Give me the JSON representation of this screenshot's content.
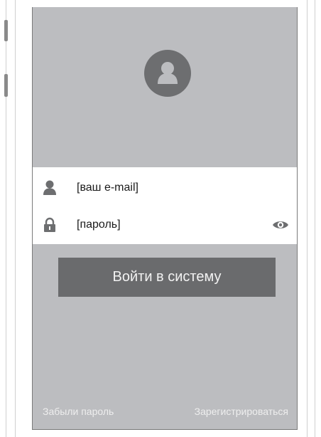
{
  "login": {
    "email_placeholder": "[ваш e-mail]",
    "password_placeholder": "[пароль]",
    "submit_label": "Войти в систему"
  },
  "footer": {
    "forgot_password": "Забыли пароль",
    "register": "Зарегистрироваться"
  },
  "icons": {
    "avatar": "user-avatar-icon",
    "email": "user-icon",
    "password": "lock-icon",
    "show_password": "eye-icon"
  },
  "colors": {
    "screen_background": "#bcbdc0",
    "form_background": "#ffffff",
    "button_background": "#6a6b6d",
    "icon_color": "#6d6e70"
  }
}
